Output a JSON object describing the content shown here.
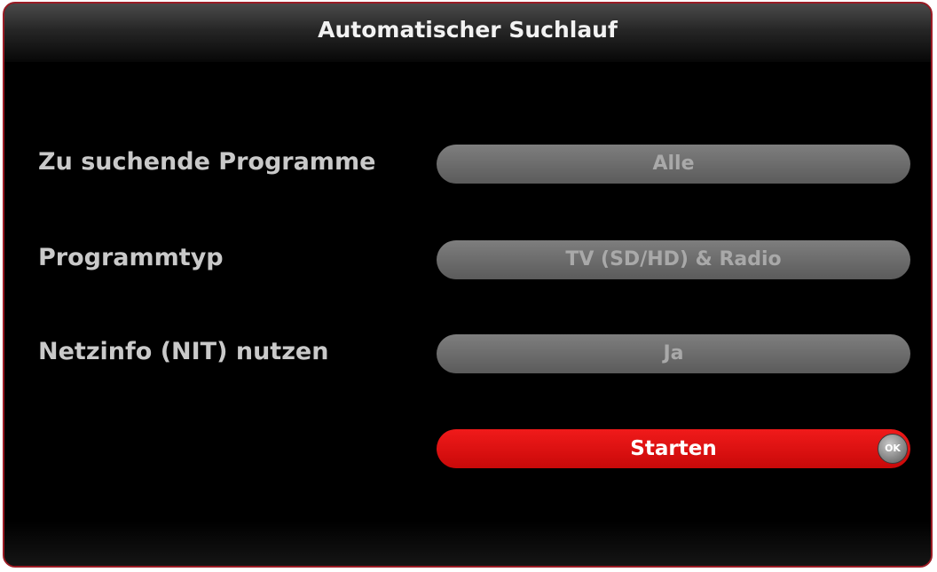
{
  "dialog": {
    "title": "Automatischer Suchlauf",
    "accent_color": "#e50f0f",
    "border_color": "#9b1c25"
  },
  "settings": [
    {
      "label": "Zu suchende Programme",
      "value": "Alle"
    },
    {
      "label": "Programmtyp",
      "value": "TV (SD/HD) & Radio"
    },
    {
      "label": "Netzinfo (NIT) nutzen",
      "value": "Ja"
    }
  ],
  "start_button": {
    "label": "Starten",
    "ok_icon": {
      "name": "ok-icon",
      "text": "OK"
    }
  }
}
